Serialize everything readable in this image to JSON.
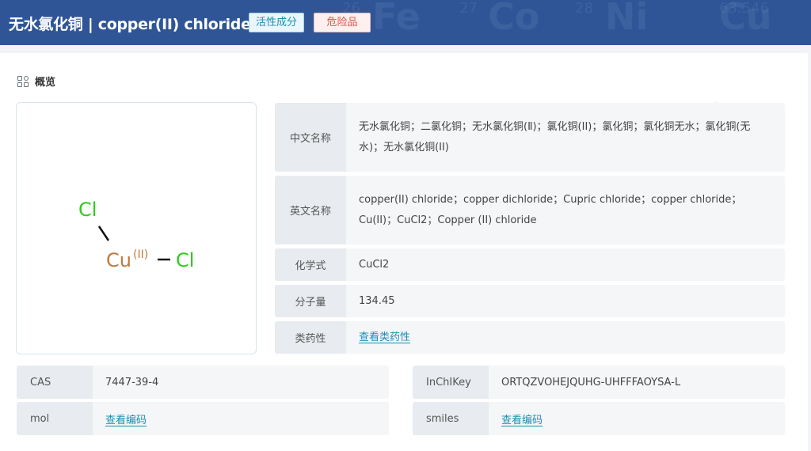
{
  "header": {
    "title": "无水氯化铜 | copper(II) chloride",
    "tag_active": "活性成分",
    "tag_danger": "危险品",
    "bg_elements": [
      {
        "sym": "Fe",
        "num": "26"
      },
      {
        "sym": "Co",
        "num": "27"
      },
      {
        "sym": "Ni",
        "num": "28"
      },
      {
        "sym": "Cu",
        "num": "63.546"
      }
    ]
  },
  "overview": {
    "title": "概览"
  },
  "structure": {
    "atom_cl_top": "Cl",
    "atom_cu": "Cu",
    "charge": "(II)",
    "atom_cl_right": "Cl",
    "colors": {
      "cl": "#2ecc1a",
      "cu": "#c07a3c",
      "bond": "#111111"
    }
  },
  "properties": [
    {
      "label": "中文名称",
      "value": "无水氯化铜；二氯化铜；无水氯化铜(Ⅱ)；氯化铜(II)；氯化铜；氯化铜无水；氯化铜(无水)；无水氯化铜(II)"
    },
    {
      "label": "英文名称",
      "value": "copper(II) chloride；copper dichloride；Cupric chloride；copper chloride；Cu(II)；CuCl2；Copper (II) chloride"
    },
    {
      "label": "化学式",
      "value": "CuCl2"
    },
    {
      "label": "分子量",
      "value": "134.45"
    },
    {
      "label": "类药性",
      "value": "查看类药性"
    }
  ],
  "identifiers": {
    "cas": {
      "label": "CAS",
      "value": "7447-39-4"
    },
    "inchikey": {
      "label": "InChIKey",
      "value": "ORTQZVOHEJQUHG-UHFFFAOYSA-L"
    },
    "mol": {
      "label": "mol",
      "value": "查看编码"
    },
    "smiles": {
      "label": "smiles",
      "value": "查看编码"
    }
  },
  "colors": {
    "header_bg": "#2f5597",
    "link": "#1a8fb0",
    "danger": "#e0504a"
  }
}
